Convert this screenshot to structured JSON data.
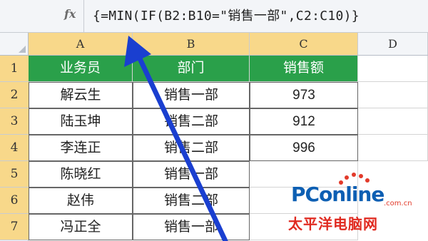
{
  "formula_bar": {
    "fx_label": "fx",
    "formula": "{=MIN(IF(B2:B10=\"销售一部\",C2:C10)}"
  },
  "columns": [
    "A",
    "B",
    "C",
    "D"
  ],
  "rows": [
    "1",
    "2",
    "3",
    "4",
    "5",
    "6",
    "7"
  ],
  "table": {
    "headers": [
      "业务员",
      "部门",
      "销售额"
    ],
    "data": [
      [
        "解云生",
        "销售一部",
        "973"
      ],
      [
        "陆玉坤",
        "销售二部",
        "912"
      ],
      [
        "李连正",
        "销售二部",
        "996"
      ],
      [
        "陈晓红",
        "销售一部",
        ""
      ],
      [
        "赵伟",
        "销售二部",
        ""
      ],
      [
        "冯正全",
        "销售一部",
        ""
      ]
    ]
  },
  "colors": {
    "header_fill": "#2aa04a",
    "selected_header": "#f8d88a",
    "arrow": "#1a3fd0"
  },
  "icons": [
    "fx-icon",
    "select-all-triangle-icon",
    "annotation-arrow-icon"
  ],
  "watermark": {
    "brand": "PConline",
    "domain": ".com.cn",
    "cn_name": "太平洋电脑网"
  }
}
